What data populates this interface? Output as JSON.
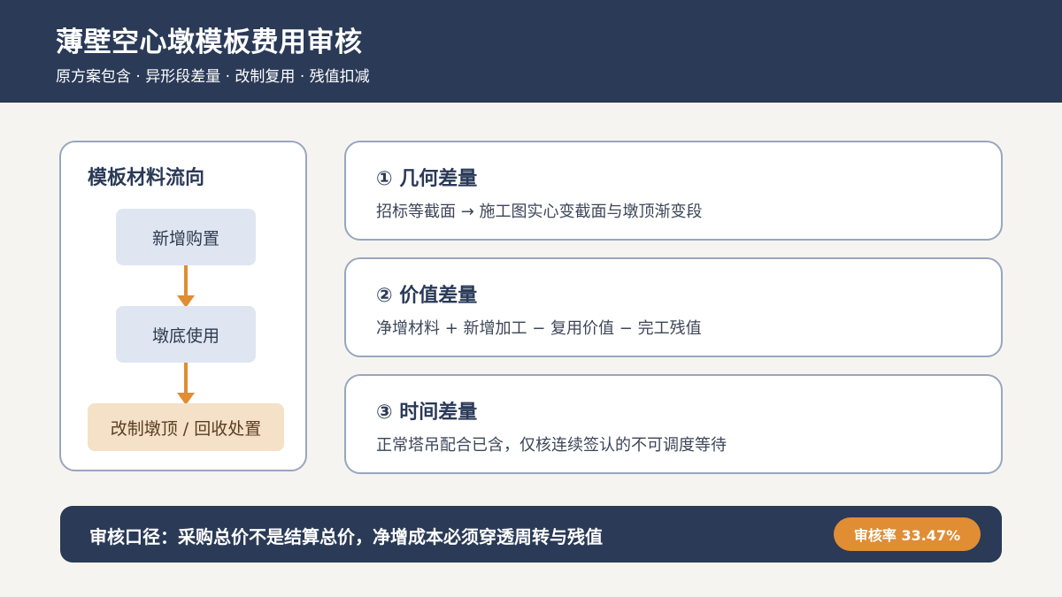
{
  "header": {
    "title": "薄壁空心墩模板费用审核",
    "subtitle": "原方案包含 · 异形段差量 · 改制复用 · 残值扣减"
  },
  "flow": {
    "title": "模板材料流向",
    "steps": [
      "新增购置",
      "墩底使用",
      "改制墩顶 / 回收处置"
    ],
    "colors": {
      "step_fill": "#dfe6f2",
      "final_fill": "#f4e1c7",
      "arrow": "#e08d33"
    }
  },
  "cards": [
    {
      "title": "① 几何差量",
      "desc": "招标等截面 → 施工图实心变截面与墩顶渐变段"
    },
    {
      "title": "② 价值差量",
      "desc": "净增材料 + 新增加工 − 复用价值 − 完工残值"
    },
    {
      "title": "③ 时间差量",
      "desc": "正常塔吊配合已含，仅核连续签认的不可调度等待"
    }
  ],
  "footer": {
    "text": "审核口径：采购总价不是结算总价，净增成本必须穿透周转与残值",
    "badge": "审核率 33.47%"
  },
  "colors": {
    "navy": "#2a3a57",
    "accent": "#e08d33",
    "background": "#f6f4f1"
  }
}
